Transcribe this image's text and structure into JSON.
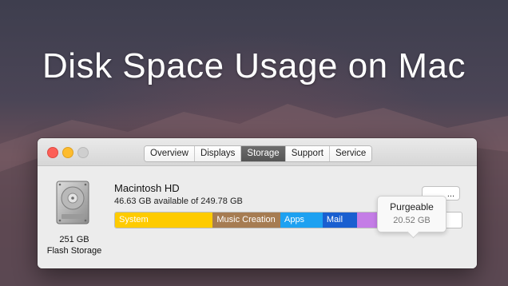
{
  "headline": "Disk Space Usage on Mac",
  "window": {
    "tabs": [
      {
        "label": "Overview"
      },
      {
        "label": "Displays"
      },
      {
        "label": "Storage",
        "active": true
      },
      {
        "label": "Support"
      },
      {
        "label": "Service"
      }
    ]
  },
  "disk": {
    "name": "Macintosh HD",
    "available": "46.63 GB available of 249.78 GB",
    "capacity": "251 GB",
    "type": "Flash Storage",
    "icon": "hard-drive-icon"
  },
  "manage_button": "...",
  "tooltip": {
    "title": "Purgeable",
    "value": "20.52 GB"
  },
  "storage_bar": {
    "segments": [
      {
        "key": "system",
        "label": "System",
        "color": "#fecb00",
        "share": 0.282
      },
      {
        "key": "music-creation",
        "label": "Music Creation",
        "color": "#a67c52",
        "share": 0.195
      },
      {
        "key": "apps",
        "label": "Apps",
        "color": "#1ea1f1",
        "share": 0.122
      },
      {
        "key": "mail",
        "label": "Mail",
        "color": "#1a5fd0",
        "share": 0.1
      },
      {
        "key": "other-1",
        "label": "",
        "color": "#c47de6",
        "share": 0.068
      },
      {
        "key": "other-2",
        "label": "",
        "color": "#ec3a35",
        "share": 0.014
      },
      {
        "key": "other-3",
        "label": "",
        "color": "#f0922a",
        "share": 0.007
      },
      {
        "key": "other-4",
        "label": "",
        "color": "#4fc84f",
        "share": 0.007
      },
      {
        "key": "other-5",
        "label": "",
        "color": "#8e8e93",
        "share": 0.005
      },
      {
        "key": "purgeable",
        "label": "",
        "color": "#d6d6d6",
        "share": 0.082
      },
      {
        "key": "free",
        "label": "",
        "color": "#ffffff",
        "share": 0.103
      }
    ]
  }
}
